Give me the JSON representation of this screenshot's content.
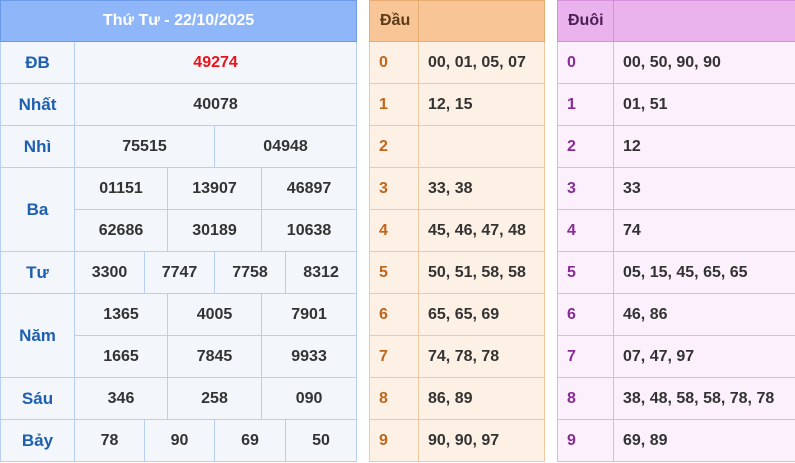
{
  "results": {
    "title": "Thứ Tư - 22/10/2025",
    "db_label": "ĐB",
    "db_value": "49274",
    "nhat_label": "Nhất",
    "nhat_value": "40078",
    "nhi_label": "Nhì",
    "nhi_values": [
      "75515",
      "04948"
    ],
    "ba_label": "Ba",
    "ba_values": [
      "01151",
      "13907",
      "46897",
      "62686",
      "30189",
      "10638"
    ],
    "tu_label": "Tư",
    "tu_values": [
      "3300",
      "7747",
      "7758",
      "8312"
    ],
    "nam_label": "Năm",
    "nam_values": [
      "1365",
      "4005",
      "7901",
      "1665",
      "7845",
      "9933"
    ],
    "sau_label": "Sáu",
    "sau_values": [
      "346",
      "258",
      "090"
    ],
    "bay_label": "Bảy",
    "bay_values": [
      "78",
      "90",
      "69",
      "50"
    ]
  },
  "dau": {
    "header": "Đầu",
    "rows": [
      {
        "key": "0",
        "values": "00, 01, 05, 07"
      },
      {
        "key": "1",
        "values": "12, 15"
      },
      {
        "key": "2",
        "values": ""
      },
      {
        "key": "3",
        "values": "33, 38"
      },
      {
        "key": "4",
        "values": "45, 46, 47, 48"
      },
      {
        "key": "5",
        "values": "50, 51, 58, 58"
      },
      {
        "key": "6",
        "values": "65, 65, 69"
      },
      {
        "key": "7",
        "values": "74, 78, 78"
      },
      {
        "key": "8",
        "values": "86, 89"
      },
      {
        "key": "9",
        "values": "90, 90, 97"
      }
    ]
  },
  "duoi": {
    "header": "Đuôi",
    "rows": [
      {
        "key": "0",
        "values": "00, 50, 90, 90"
      },
      {
        "key": "1",
        "values": "01, 51"
      },
      {
        "key": "2",
        "values": "12"
      },
      {
        "key": "3",
        "values": "33"
      },
      {
        "key": "4",
        "values": "74"
      },
      {
        "key": "5",
        "values": "05, 15, 45, 65, 65"
      },
      {
        "key": "6",
        "values": "46, 86"
      },
      {
        "key": "7",
        "values": "07, 47, 97"
      },
      {
        "key": "8",
        "values": "38, 48, 58, 58, 78, 78"
      },
      {
        "key": "9",
        "values": "69, 89"
      }
    ]
  },
  "colors": {
    "results_header": "#8fb6f8",
    "dau_header": "#f8c597",
    "duoi_header": "#eab3ee",
    "db_value": "#e8131c",
    "label_blue": "#1d5fb0"
  }
}
